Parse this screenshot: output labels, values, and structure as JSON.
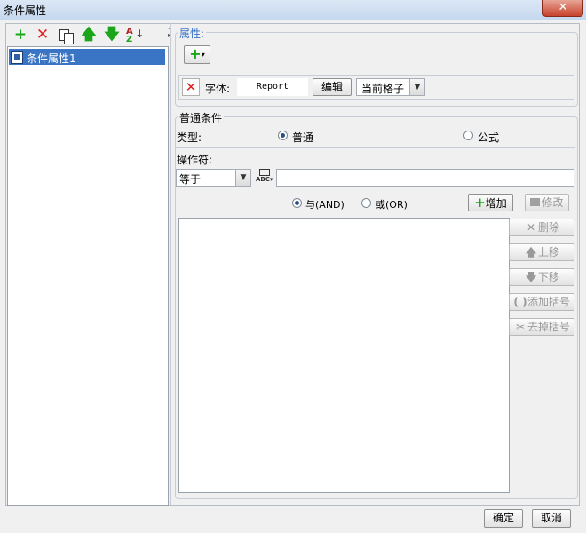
{
  "window": {
    "title": "条件属性",
    "close_glyph": "✕"
  },
  "toolbar": {
    "icons": [
      "plus-icon",
      "delete-icon",
      "copy-icon",
      "arrow-up-icon",
      "arrow-down-icon",
      "sort-icon"
    ]
  },
  "tree": {
    "items": [
      {
        "label": "条件属性1"
      }
    ]
  },
  "attribute": {
    "group_label": "属性:",
    "font_label": "字体:",
    "font_preview": "__ Report __",
    "edit_button": "编辑",
    "scope_value": "当前格子"
  },
  "condition": {
    "group_label": "普通条件",
    "type_label": "类型:",
    "type_normal": "普通",
    "type_formula": "公式",
    "operator_label": "操作符:",
    "operator_value": "等于",
    "value_text": "",
    "and_label": "与(AND)",
    "or_label": "或(OR)",
    "add_button": "增加",
    "modify_button": "修改",
    "side_buttons": {
      "delete": "删除",
      "up": "上移",
      "down": "下移",
      "add_bracket": "添加括号",
      "remove_bracket": "去掉括号"
    }
  },
  "footer": {
    "ok": "确定",
    "cancel": "取消"
  },
  "colors": {
    "accent": "#3a74c4",
    "green": "#1aa51a",
    "red": "#e02020",
    "legend_blue": "#3b73c5"
  }
}
